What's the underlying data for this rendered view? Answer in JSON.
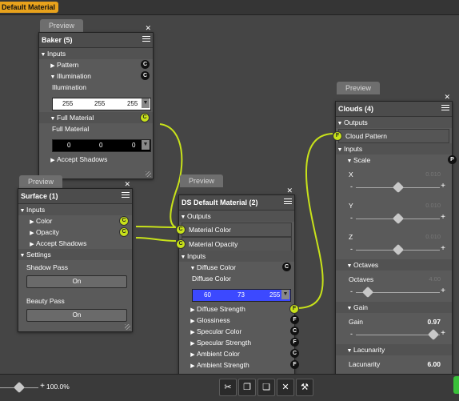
{
  "window": {
    "active_tab": "Default Material"
  },
  "preview_label": "Preview",
  "baker": {
    "title": "Baker (5)",
    "inputs_label": "Inputs",
    "pattern_label": "Pattern",
    "pattern_badge": "C",
    "illumination_label": "Illumination",
    "illumination_badge": "C",
    "illumination_sub": "Illumination",
    "illumination_rgb": [
      "255",
      "255",
      "255"
    ],
    "full_material_label": "Full Material",
    "full_material_badge": "C",
    "full_material_sub": "Full Material",
    "full_material_rgb": [
      "0",
      "0",
      "0"
    ],
    "accept_shadows_label": "Accept Shadows"
  },
  "surface": {
    "title": "Surface (1)",
    "inputs_label": "Inputs",
    "color_label": "Color",
    "color_badge": "C",
    "opacity_label": "Opacity",
    "opacity_badge": "C",
    "accept_shadows_label": "Accept Shadows",
    "settings_label": "Settings",
    "shadow_pass_label": "Shadow Pass",
    "shadow_pass_value": "On",
    "beauty_pass_label": "Beauty Pass",
    "beauty_pass_value": "On"
  },
  "ds_material": {
    "title": "DS Default Material (2)",
    "outputs_label": "Outputs",
    "material_color_label": "Material Color",
    "material_color_badge": "C",
    "material_opacity_label": "Material Opacity",
    "material_opacity_badge": "C",
    "inputs_label": "Inputs",
    "diffuse_color_label": "Diffuse Color",
    "diffuse_color_badge": "C",
    "diffuse_color_sub": "Diffuse Color",
    "diffuse_rgb": [
      "60",
      "73",
      "255"
    ],
    "diffuse_swatch": "#3c49ff",
    "rows": [
      {
        "label": "Diffuse Strength",
        "badge": "F",
        "yellow": true
      },
      {
        "label": "Glossiness",
        "badge": "F",
        "yellow": false
      },
      {
        "label": "Specular Color",
        "badge": "C",
        "yellow": false
      },
      {
        "label": "Specular Strength",
        "badge": "F",
        "yellow": false
      },
      {
        "label": "Ambient Color",
        "badge": "C",
        "yellow": false
      },
      {
        "label": "Ambient Strength",
        "badge": "F",
        "yellow": false
      }
    ]
  },
  "clouds": {
    "title": "Clouds (4)",
    "outputs_label": "Outputs",
    "cloud_pattern_label": "Cloud Pattern",
    "cloud_pattern_badge": "F",
    "inputs_label": "Inputs",
    "scale_label": "Scale",
    "scale_badge": "P",
    "x_label": "X",
    "x_value": "0.010",
    "x_level": 0.5,
    "y_label": "Y",
    "y_value": "0.010",
    "y_level": 0.5,
    "z_label": "Z",
    "z_value": "0.010",
    "z_level": 0.5,
    "octaves_header": "Octaves",
    "octaves_label": "Octaves",
    "octaves_value": "4.00",
    "octaves_level": 0.1,
    "gain_header": "Gain",
    "gain_label": "Gain",
    "gain_value": "0.97",
    "gain_level": 0.97,
    "lacunarity_header": "Lacunarity",
    "lacunarity_label": "Lacunarity",
    "lacunarity_value": "6.00"
  },
  "bottom": {
    "zoom_value": "100.0%",
    "zoom_level": 0.5
  },
  "colors": {
    "wire": "#c8e21a",
    "accent": "#e8a21c"
  }
}
